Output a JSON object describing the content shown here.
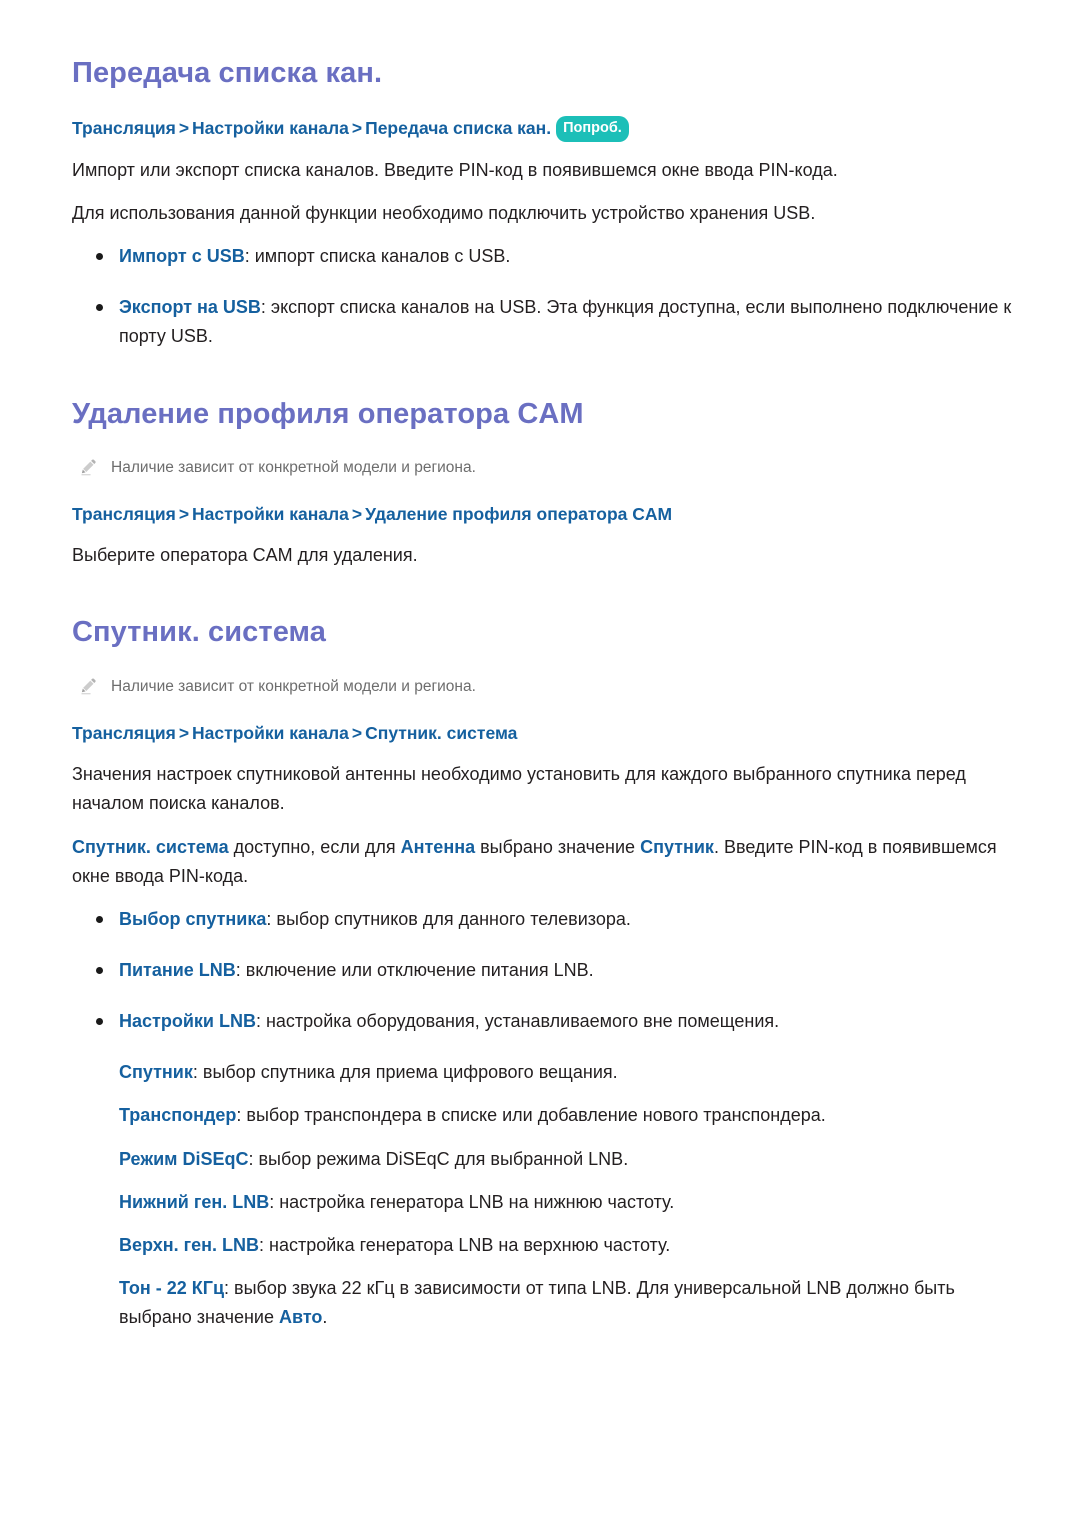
{
  "document": {
    "language": "ru",
    "background": "#ffffff",
    "heading_color": "#6a6fc2",
    "link_color": "#15609f",
    "body_color": "#231f20",
    "note_color": "#6d6d6d",
    "badge_color": "#1cbfb8"
  },
  "sections": [
    {
      "id": "channel-list-transfer",
      "title": "Передача списка кан.",
      "breadcrumb": {
        "crumb1": "Трансляция",
        "sep1": ">",
        "crumb2": "Настройки канала",
        "sep2": ">",
        "crumb3": "Передача списка кан.",
        "badge": "Попроб."
      },
      "paragraphs": [
        "Импорт или экспорт списка каналов. Введите PIN-код в появившемся окне ввода PIN-кода.",
        "Для использования данной функции необходимо подключить устройство хранения USB."
      ],
      "bullets": [
        {
          "term": "Импорт с USB",
          "rest": ": импорт списка каналов с USB."
        },
        {
          "term": "Экспорт на USB",
          "rest": ": экспорт списка каналов на USB. Эта функция доступна, если выполнено подключение к порту USB."
        }
      ]
    },
    {
      "id": "cam-operator-profile-delete",
      "title": "Удаление профиля оператора CAM",
      "note": "Наличие зависит от конкретной модели и региона.",
      "note_icon": "pencil-icon",
      "breadcrumb": {
        "crumb1": "Трансляция",
        "sep1": ">",
        "crumb2": "Настройки канала",
        "sep2": ">",
        "crumb3": "Удаление профиля оператора CAM"
      },
      "paragraphs": [
        "Выберите оператора CAM для удаления."
      ]
    },
    {
      "id": "satellite-system",
      "title": "Спутник. система",
      "note": "Наличие зависит от конкретной модели и региона.",
      "note_icon": "pencil-icon",
      "breadcrumb": {
        "crumb1": "Трансляция",
        "sep1": ">",
        "crumb2": "Настройки канала",
        "sep2": ">",
        "crumb3": "Спутник. система"
      },
      "intro": "Значения настроек спутниковой антенны необходимо установить для каждого выбранного спутника перед началом поиска каналов.",
      "availability": {
        "kw1": "Спутник. система",
        "mid1": " доступно, если для ",
        "kw2": "Антенна",
        "mid2": " выбрано значение ",
        "kw3": "Спутник",
        "tail": ". Введите PIN-код в появившемся окне ввода PIN-кода."
      },
      "bullets": [
        {
          "dot": true,
          "term": "Выбор спутника",
          "rest": ": выбор спутников для данного телевизора."
        },
        {
          "dot": true,
          "term": "Питание LNB",
          "rest": ": включение или отключение питания LNB."
        },
        {
          "dot": true,
          "term": "Настройки LNB",
          "rest": ": настройка оборудования, устанавливаемого вне помещения."
        },
        {
          "dot": false,
          "term": "Спутник",
          "rest": ": выбор спутника для приема цифрового вещания."
        },
        {
          "dot": false,
          "term": "Транспондер",
          "rest": ": выбор транспондера в списке или добавление нового транспондера."
        },
        {
          "dot": false,
          "term": "Режим DiSEqC",
          "rest": ": выбор режима DiSEqC для выбранной LNB."
        },
        {
          "dot": false,
          "term": "Нижний ген. LNB",
          "rest": ": настройка генератора LNB на нижнюю частоту."
        },
        {
          "dot": false,
          "term": "Верхн. ген. LNB",
          "rest": ": настройка генератора LNB на верхнюю частоту."
        }
      ],
      "tone": {
        "term": "Тон - 22 КГц",
        "mid": ": выбор звука 22 кГц в зависимости от типа LNB. Для универсальной LNB должно быть выбрано значение ",
        "kw": "Авто",
        "tail": "."
      }
    }
  ]
}
